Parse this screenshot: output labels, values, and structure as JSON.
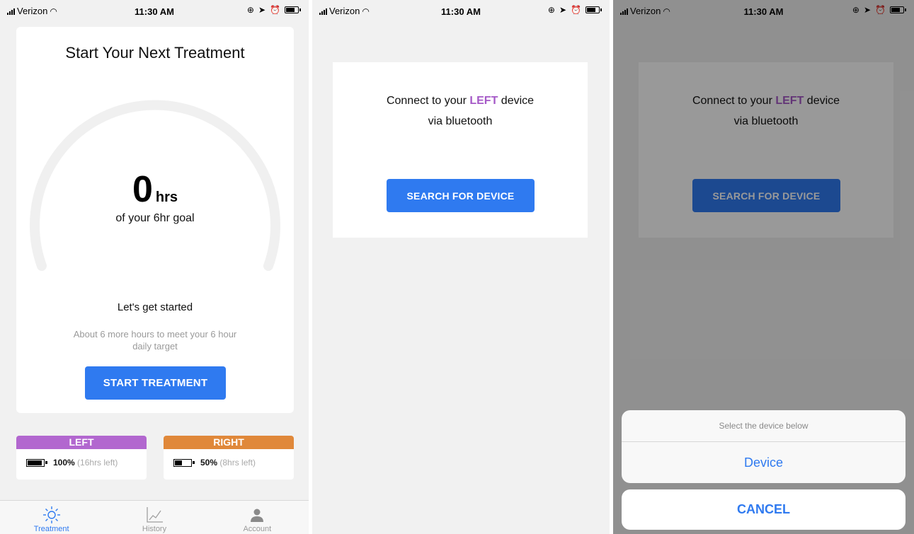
{
  "status_bar": {
    "carrier": "Verizon",
    "time": "11:30 AM"
  },
  "screen1": {
    "title": "Start Your Next Treatment",
    "hours_value": "0",
    "hours_unit": "hrs",
    "goal_text": "of your 6hr goal",
    "lets_text": "Let's get started",
    "about_text": "About 6 more hours to meet your 6 hour daily target",
    "start_button": "START TREATMENT",
    "left_device": {
      "label": "LEFT",
      "color": "#b267cf",
      "percent": "100%",
      "remaining": "(16hrs left)",
      "level": 1.0
    },
    "right_device": {
      "label": "RIGHT",
      "color": "#e0883a",
      "percent": "50%",
      "remaining": "(8hrs left)",
      "level": 0.5
    },
    "tabs": [
      {
        "label": "Treatment",
        "icon": "sun-icon",
        "active": true
      },
      {
        "label": "History",
        "icon": "chart-icon",
        "active": false
      },
      {
        "label": "Account",
        "icon": "person-icon",
        "active": false
      }
    ]
  },
  "screen2": {
    "msg_prefix": "Connect to your ",
    "msg_highlight": "LEFT",
    "msg_suffix": " device",
    "msg_line2": "via bluetooth",
    "search_button": "SEARCH FOR DEVICE"
  },
  "screen3": {
    "sheet_title": "Select the device below",
    "device_option": "Device",
    "cancel": "CANCEL"
  },
  "colors": {
    "accent": "#2f7af0",
    "highlight": "#a559c7"
  }
}
